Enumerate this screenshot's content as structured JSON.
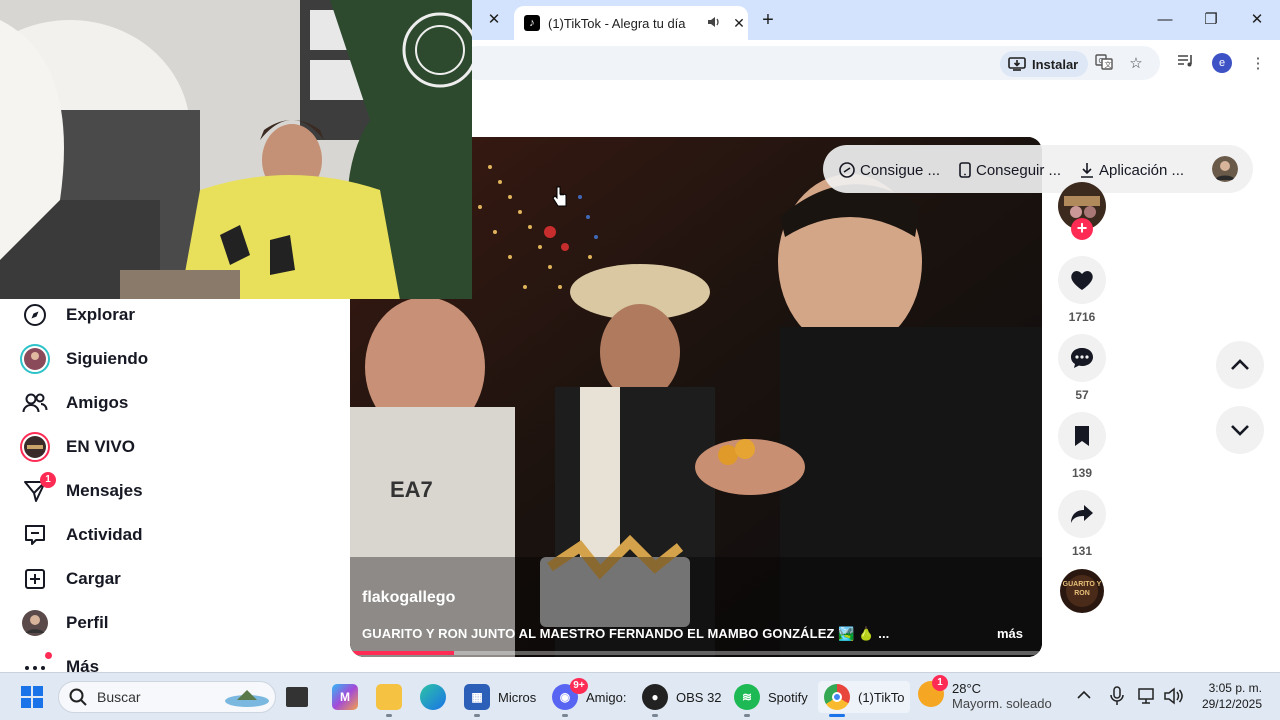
{
  "browser": {
    "tab_title": "(1)TikTok - Alegra tu día",
    "install_label": "Instalar",
    "profile_initial": "e"
  },
  "sidebar": {
    "items": [
      {
        "label": "Explorar",
        "icon": "compass-icon"
      },
      {
        "label": "Siguiendo",
        "icon": "following-avatar-icon"
      },
      {
        "label": "Amigos",
        "icon": "friends-icon"
      },
      {
        "label": "EN VIVO",
        "icon": "live-avatar-icon"
      },
      {
        "label": "Mensajes",
        "icon": "messages-icon",
        "badge": "1"
      },
      {
        "label": "Actividad",
        "icon": "activity-icon"
      },
      {
        "label": "Cargar",
        "icon": "upload-icon"
      },
      {
        "label": "Perfil",
        "icon": "profile-avatar-icon"
      },
      {
        "label": "Más",
        "icon": "more-icon"
      }
    ]
  },
  "header": {
    "pills": [
      "Consigue ...",
      "Conseguir ...",
      "Aplicación ..."
    ]
  },
  "video": {
    "author": "flakogallego",
    "caption": "GUARITO Y RON JUNTO AL MAESTRO FERNANDO EL MAMBO GONZÁLEZ 🏞️ 🍐 ...",
    "more_label": "más",
    "progress": 0.15
  },
  "actions": {
    "likes": "1716",
    "comments": "57",
    "saves": "139",
    "shares": "131"
  },
  "music": {
    "disc_text": "GUARITO Y RON"
  },
  "taskbar": {
    "search_placeholder": "Buscar",
    "apps": [
      {
        "label": "Micros",
        "color": "#2b5fb8"
      },
      {
        "label": "Amigo:",
        "color": "#5865f2",
        "badge": "9+"
      },
      {
        "label": "OBS 32",
        "color": "#222222"
      },
      {
        "label": "Spotify",
        "color": "#1db954"
      },
      {
        "label": "(1)TikTo",
        "color": "#e8453c"
      }
    ],
    "weather_temp": "28°C",
    "weather_desc": "Mayorm. soleado",
    "weather_badge": "1",
    "time": "3:05 p. m.",
    "date": "29/12/2025"
  },
  "colors": {
    "accent": "#fe2c55",
    "tabbar": "#d3e3fd",
    "taskbar": "#dfe8f3"
  }
}
